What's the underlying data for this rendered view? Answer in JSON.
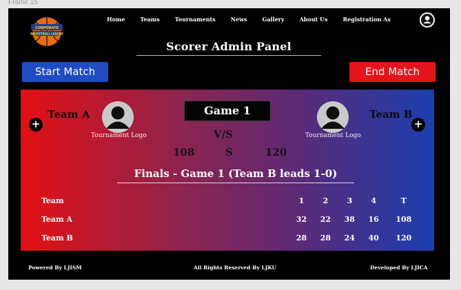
{
  "frame_label": "Frame 15",
  "header": {
    "logo_text": "CORPORATE BASKETBALL LEAGUE",
    "nav": [
      "Home",
      "Teams",
      "Tournaments",
      "News",
      "Gallery",
      "About Us",
      "Registration As"
    ],
    "profile_icon": "user-icon"
  },
  "title": "Scorer Admin Panel",
  "buttons": {
    "start": "Start Match",
    "end": "End Match"
  },
  "colors": {
    "start": "#1e4bc2",
    "end": "#e3141b",
    "gradient_left": "#e31013",
    "gradient_right": "#1b3fb0"
  },
  "match": {
    "game": "Game 1",
    "vs": "V/S",
    "team_a": {
      "name": "Team A",
      "logo_caption": "Tournament Logo",
      "score": "108"
    },
    "team_b": {
      "name": "Team B",
      "logo_caption": "Tournament Logo",
      "score": "120"
    },
    "score_sep": "S",
    "subtitle": "Finals - Game 1 (Team B leads 1-0)",
    "add_icon": "plus-icon"
  },
  "table": {
    "headers": [
      "Team",
      "1",
      "2",
      "3",
      "4",
      "T"
    ],
    "rows": [
      [
        "Team A",
        "32",
        "22",
        "38",
        "16",
        "108"
      ],
      [
        "Team B",
        "28",
        "28",
        "24",
        "40",
        "120"
      ]
    ]
  },
  "footer": {
    "left": "Powered By LJISM",
    "center": "All Rights Reserved By LJKU",
    "right": "Developed By LJICA"
  }
}
